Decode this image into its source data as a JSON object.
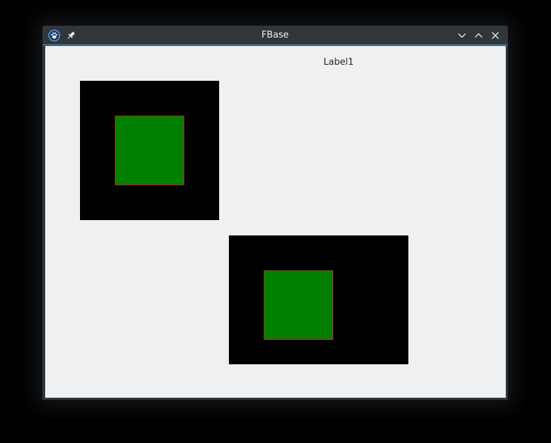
{
  "window": {
    "title": "FBase",
    "icons": {
      "app": "app-paw-icon",
      "pin": "pin-icon",
      "minimize": "chevron-down-icon",
      "maximize": "chevron-up-icon",
      "close": "close-icon"
    },
    "accent_color": "#3daee9"
  },
  "content": {
    "label1": "Label1",
    "canvas_background": "#000000",
    "square_fill": "#008000",
    "square_border": "#b0281c"
  }
}
